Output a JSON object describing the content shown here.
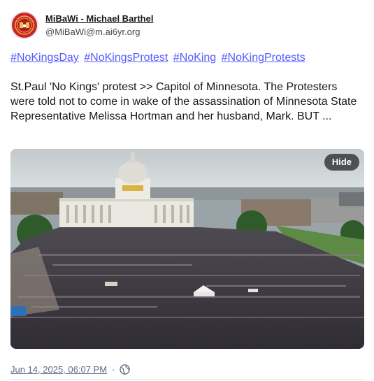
{
  "account": {
    "display_name": "MiBaWi - Michael Barthel",
    "handle": "@MiBaWi@m.ai6yr.org",
    "avatar_icon": "seal-avatar-icon"
  },
  "post": {
    "hashtags": [
      "#NoKingsDay",
      "#NoKingsProtest",
      "#NoKing",
      "#NoKingProtests"
    ],
    "body": "St.Paul 'No Kings' protest >> Capitol of Minnesota. The Protesters were told not to come in wake of the assassination of Minnesota State Representative Melissa Hortman and her husband, Mark. BUT ...",
    "media": {
      "hide_label": "Hide"
    },
    "timestamp": "Jun 14, 2025, 06:07 PM",
    "separator": "·",
    "visibility_icon": "globe-icon"
  },
  "colors": {
    "link": "#595aff",
    "muted": "#606984",
    "text": "#17181a"
  }
}
